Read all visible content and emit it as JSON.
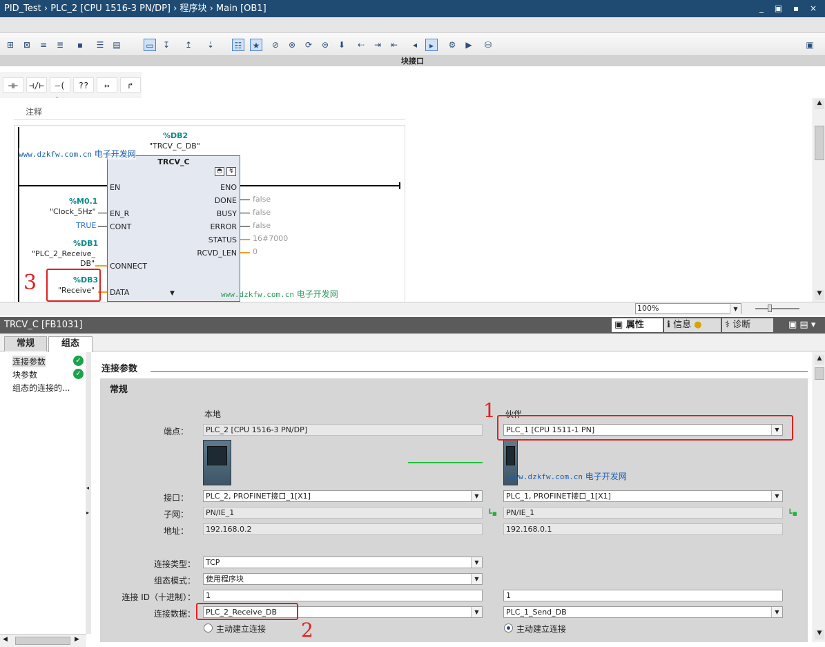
{
  "titlebar": {
    "path": "PID_Test  ›  PLC_2 [CPU 1516-3 PN/DP]  ›  程序块  ›  Main [OB1]",
    "window_buttons": "_ ▣ ▪ ×"
  },
  "iface_bar": {
    "label": "块接口"
  },
  "ladder_buttons": [
    "⊣⊢",
    "⊣/⊢",
    "–( )–",
    "??",
    "↦",
    "↱"
  ],
  "editor": {
    "comment_label": "注释",
    "block": {
      "instance_addr": "%DB2",
      "instance_name": "\"TRCV_C_DB\"",
      "type": "TRCV_C",
      "inputs": [
        "EN",
        "EN_R",
        "CONT",
        "CONNECT",
        "DATA"
      ],
      "outputs": [
        "ENO",
        "DONE",
        "BUSY",
        "ERROR",
        "STATUS",
        "RCVD_LEN"
      ],
      "output_values": {
        "done": "false",
        "busy": "false",
        "error": "false",
        "status": "16#7000",
        "rcvd_len": "0"
      }
    },
    "operands": {
      "en_r_addr": "%M0.1",
      "en_r_name": "\"Clock_5Hz\"",
      "cont_val": "TRUE",
      "connect_addr": "%DB1",
      "connect_name_1": "\"PLC_2_Receive_",
      "connect_name_2": "DB\"",
      "data_addr": "%DB3",
      "data_name": "\"Receive\""
    },
    "watermark_text": "www.dzkfw.com.cn",
    "watermark_cn": "电子开发网"
  },
  "zoom": {
    "value": "100%"
  },
  "properties": {
    "header_title": "TRCV_C [FB1031]",
    "header_tabs": [
      "属性",
      "信息",
      "诊断"
    ],
    "tabs": [
      "常规",
      "组态"
    ],
    "nav": [
      {
        "label": "连接参数"
      },
      {
        "label": "块参数"
      },
      {
        "label": "组态的连接的..."
      }
    ],
    "section_title": "连接参数",
    "group_title": "常规",
    "local_heading": "本地",
    "partner_heading": "伙伴",
    "fields": {
      "endpoint_label": "端点：",
      "local_endpoint": "PLC_2 [CPU 1516-3 PN/DP]",
      "partner_endpoint": "PLC_1 [CPU 1511-1 PN]",
      "interface_label": "接口：",
      "local_interface": "PLC_2, PROFINET接口_1[X1]",
      "partner_interface": "PLC_1, PROFINET接口_1[X1]",
      "subnet_label": "子网：",
      "local_subnet": "PN/IE_1",
      "partner_subnet": "PN/IE_1",
      "address_label": "地址：",
      "local_address": "192.168.0.2",
      "partner_address": "192.168.0.1",
      "conn_type_label": "连接类型：",
      "conn_type": "TCP",
      "config_mode_label": "组态模式：",
      "config_mode": "使用程序块",
      "conn_id_label": "连接 ID（十进制）：",
      "local_conn_id": "1",
      "partner_conn_id": "1",
      "conn_data_label": "连接数据：",
      "local_conn_data": "PLC_2_Receive_DB",
      "partner_conn_data": "PLC_1_Send_DB",
      "active_conn_label": "主动建立连接"
    },
    "radio_local_checked": false,
    "radio_partner_checked": true
  },
  "annotations": {
    "mark1": "1",
    "mark2": "2",
    "mark3": "3"
  },
  "colors": {
    "title_bg": "#1f4b73",
    "accent_teal": "#0a8a8a",
    "annotation_red": "#e02020",
    "ok_green": "#1aa34a"
  }
}
